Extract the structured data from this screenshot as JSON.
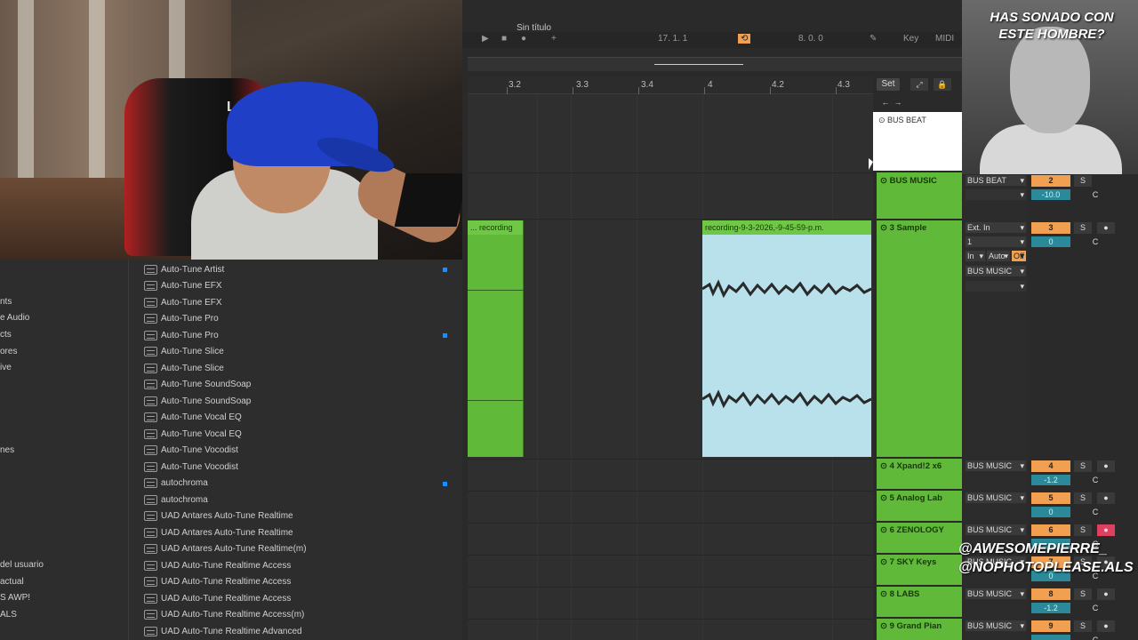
{
  "overlay": {
    "title_line1": "HAS SONADO CON",
    "title_line2": "ESTE HOMBRE?",
    "handle1": "@AWESOMEPIERRE_",
    "handle2": "@NOPHOTOPLEASE.ALS",
    "chair_brand": "LPHA"
  },
  "browser": {
    "sidebar": [
      "nts",
      "e Audio",
      "cts",
      "ores",
      "ive",
      "nes",
      "del usuario",
      "actual",
      "S AWP!",
      "ALS"
    ],
    "plugins": [
      {
        "label": "Auto-Tune Artist",
        "dot": true
      },
      {
        "label": "Auto-Tune EFX",
        "dot": false
      },
      {
        "label": "Auto-Tune EFX",
        "dot": false
      },
      {
        "label": "Auto-Tune Pro",
        "dot": false
      },
      {
        "label": "Auto-Tune Pro",
        "dot": true
      },
      {
        "label": "Auto-Tune Slice",
        "dot": false
      },
      {
        "label": "Auto-Tune Slice",
        "dot": false
      },
      {
        "label": "Auto-Tune SoundSoap",
        "dot": false
      },
      {
        "label": "Auto-Tune SoundSoap",
        "dot": false
      },
      {
        "label": "Auto-Tune Vocal EQ",
        "dot": false
      },
      {
        "label": "Auto-Tune Vocal EQ",
        "dot": false
      },
      {
        "label": "Auto-Tune Vocodist",
        "dot": false
      },
      {
        "label": "Auto-Tune Vocodist",
        "dot": false
      },
      {
        "label": "autochroma",
        "dot": true
      },
      {
        "label": "autochroma",
        "dot": false
      },
      {
        "label": "UAD Antares Auto-Tune Realtime",
        "dot": false
      },
      {
        "label": "UAD Antares Auto-Tune Realtime",
        "dot": false
      },
      {
        "label": "UAD Antares Auto-Tune Realtime(m)",
        "dot": false
      },
      {
        "label": "UAD Auto-Tune Realtime Access",
        "dot": false
      },
      {
        "label": "UAD Auto-Tune Realtime Access",
        "dot": false
      },
      {
        "label": "UAD Auto-Tune Realtime Access",
        "dot": false
      },
      {
        "label": "UAD Auto-Tune Realtime Access(m)",
        "dot": false
      },
      {
        "label": "UAD Auto-Tune Realtime Advanced",
        "dot": false
      }
    ]
  },
  "daw": {
    "title": "Sin título",
    "toolbar": {
      "position": "17. 1. 1",
      "loop_len": "8. 0. 0",
      "key": "Key",
      "midi": "MIDI"
    },
    "ruler": [
      "3.2",
      "3.3",
      "3.4",
      "4",
      "4.2",
      "4.3"
    ],
    "set_label": "Set",
    "clip1": "... recording",
    "clip2": "recording-9-3-2026,-9-45-59-p.m.",
    "bus_beat": "BUS BEAT",
    "tracks": [
      {
        "name": "BUS MUSIC",
        "route": "BUS BEAT",
        "num": "2",
        "vol": "-10.0"
      },
      {
        "name": "3 Sample",
        "route": "Ext. In",
        "num": "3",
        "vol": "0",
        "sub": "1",
        "monitor": [
          "In",
          "Auto",
          "Off"
        ],
        "out": "BUS MUSIC"
      },
      {
        "name": "4 Xpand!2  x6",
        "route": "BUS MUSIC",
        "num": "4",
        "vol": "-1.2"
      },
      {
        "name": "5 Analog Lab",
        "route": "BUS MUSIC",
        "num": "5",
        "vol": "0"
      },
      {
        "name": "6 ZENOLOGY",
        "route": "BUS MUSIC",
        "num": "6",
        "vol": ""
      },
      {
        "name": "7 SKY Keys",
        "route": "BUS MUSIC",
        "num": "7",
        "vol": "0"
      },
      {
        "name": "8 LABS",
        "route": "BUS MUSIC",
        "num": "8",
        "vol": "-1.2"
      },
      {
        "name": "9 Grand Pian",
        "route": "BUS MUSIC",
        "num": "9",
        "vol": ""
      }
    ],
    "solo": "S",
    "center": "C"
  }
}
